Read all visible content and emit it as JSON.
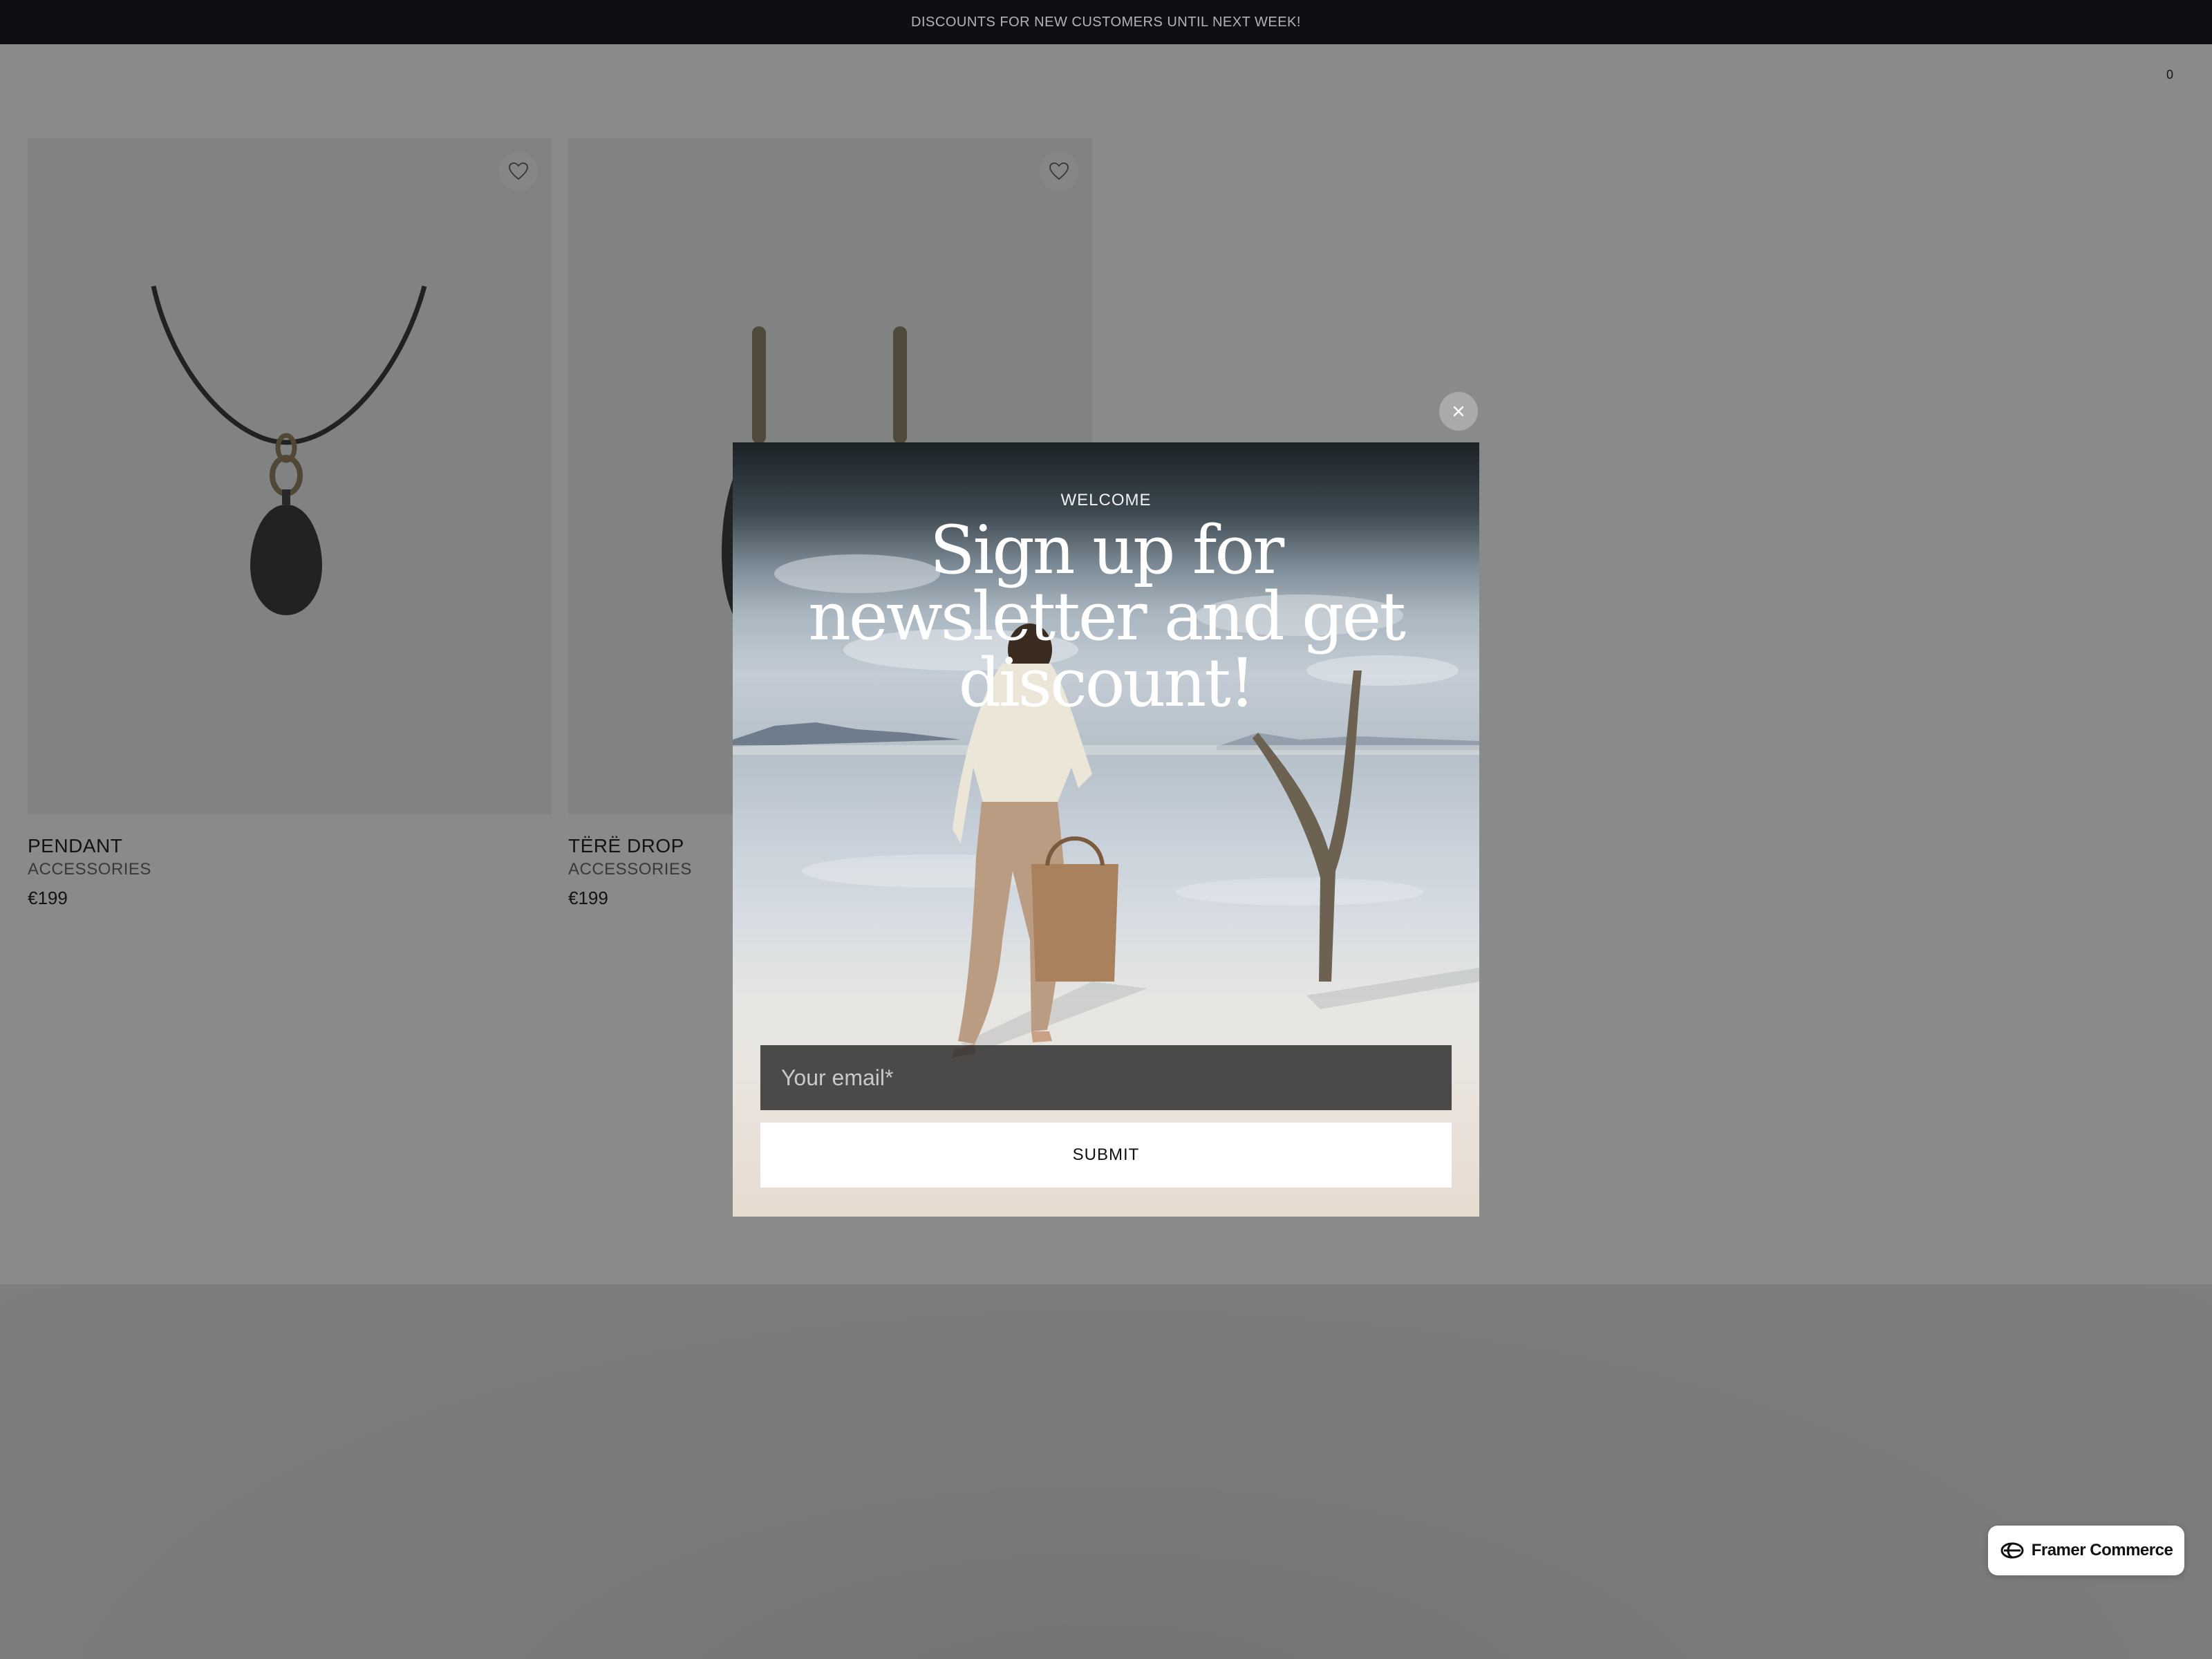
{
  "announcement": {
    "text": "DISCOUNTS FOR NEW CUSTOMERS UNTIL NEXT WEEK!"
  },
  "header": {
    "cart_count": "0"
  },
  "products": [
    {
      "name": "PENDANT",
      "category": "ACCESSORIES",
      "price": "€199"
    },
    {
      "name": "TËRË DROP",
      "category": "ACCESSORIES",
      "price": "€199"
    }
  ],
  "popup": {
    "eyebrow": "WELCOME",
    "headline": "Sign up for newsletter and get discount!",
    "email_placeholder": "Your email*",
    "submit_label": "SUBMIT"
  },
  "badge": {
    "label": "Framer Commerce"
  },
  "icons": {
    "close": "close-icon",
    "favorite": "heart-icon",
    "brand": "framer-commerce-logo-icon"
  }
}
